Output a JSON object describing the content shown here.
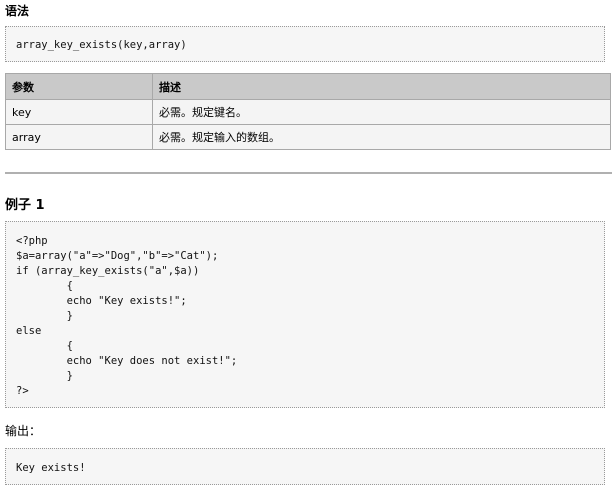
{
  "syntax": {
    "heading": "语法",
    "code": "array_key_exists(key,array)"
  },
  "params": {
    "headers": [
      "参数",
      "描述"
    ],
    "rows": [
      [
        "key",
        "必需。规定键名。"
      ],
      [
        "array",
        "必需。规定输入的数组。"
      ]
    ]
  },
  "example": {
    "heading": "例子 1",
    "code_lines": [
      "<?php",
      "$a=array(\"a\"=>\"Dog\",\"b\"=>\"Cat\");",
      "if (array_key_exists(\"a\",$a))",
      "        {",
      "        echo \"Key exists!\";",
      "        }",
      "else",
      "        {",
      "        echo \"Key does not exist!\";",
      "        }",
      "?>"
    ]
  },
  "output": {
    "label": "输出：",
    "text": "Key exists!"
  }
}
